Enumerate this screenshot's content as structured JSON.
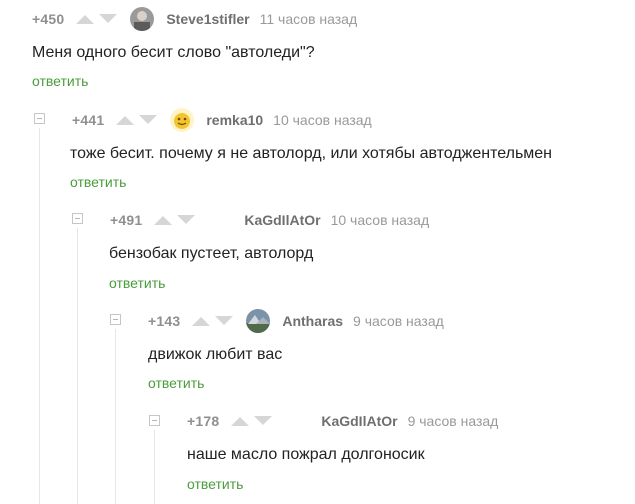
{
  "comments": [
    {
      "rating": "+450",
      "author": "Steve1stifler",
      "time": "11 часов назад",
      "text": "Меня одного бесит слово \"автоледи\"?",
      "reply_label": "ответить",
      "avatar": "photo-avatar"
    },
    {
      "rating": "+441",
      "author": "remka10",
      "time": "10 часов назад",
      "text": "тоже бесит. почему я не автолорд, или хотябы автоджентельмен",
      "reply_label": "ответить",
      "avatar": "yellow-avatar"
    },
    {
      "rating": "+491",
      "author": "KaGdIlAtOr",
      "time": "10 часов назад",
      "text": "бензобак пустеет, автолорд",
      "reply_label": "ответить",
      "avatar": "none"
    },
    {
      "rating": "+143",
      "author": "Antharas",
      "time": "9 часов назад",
      "text": "движок любит вас",
      "reply_label": "ответить",
      "avatar": "landscape-avatar"
    },
    {
      "rating": "+178",
      "author": "KaGdIlAtOr",
      "time": "9 часов назад",
      "text": "наше масло пожрал долгоносик",
      "reply_label": "ответить",
      "avatar": "none"
    }
  ],
  "colors": {
    "reply": "#4a9c3c",
    "rating": "#8f8f8f",
    "author": "#6f6f6f",
    "time": "#999999"
  }
}
